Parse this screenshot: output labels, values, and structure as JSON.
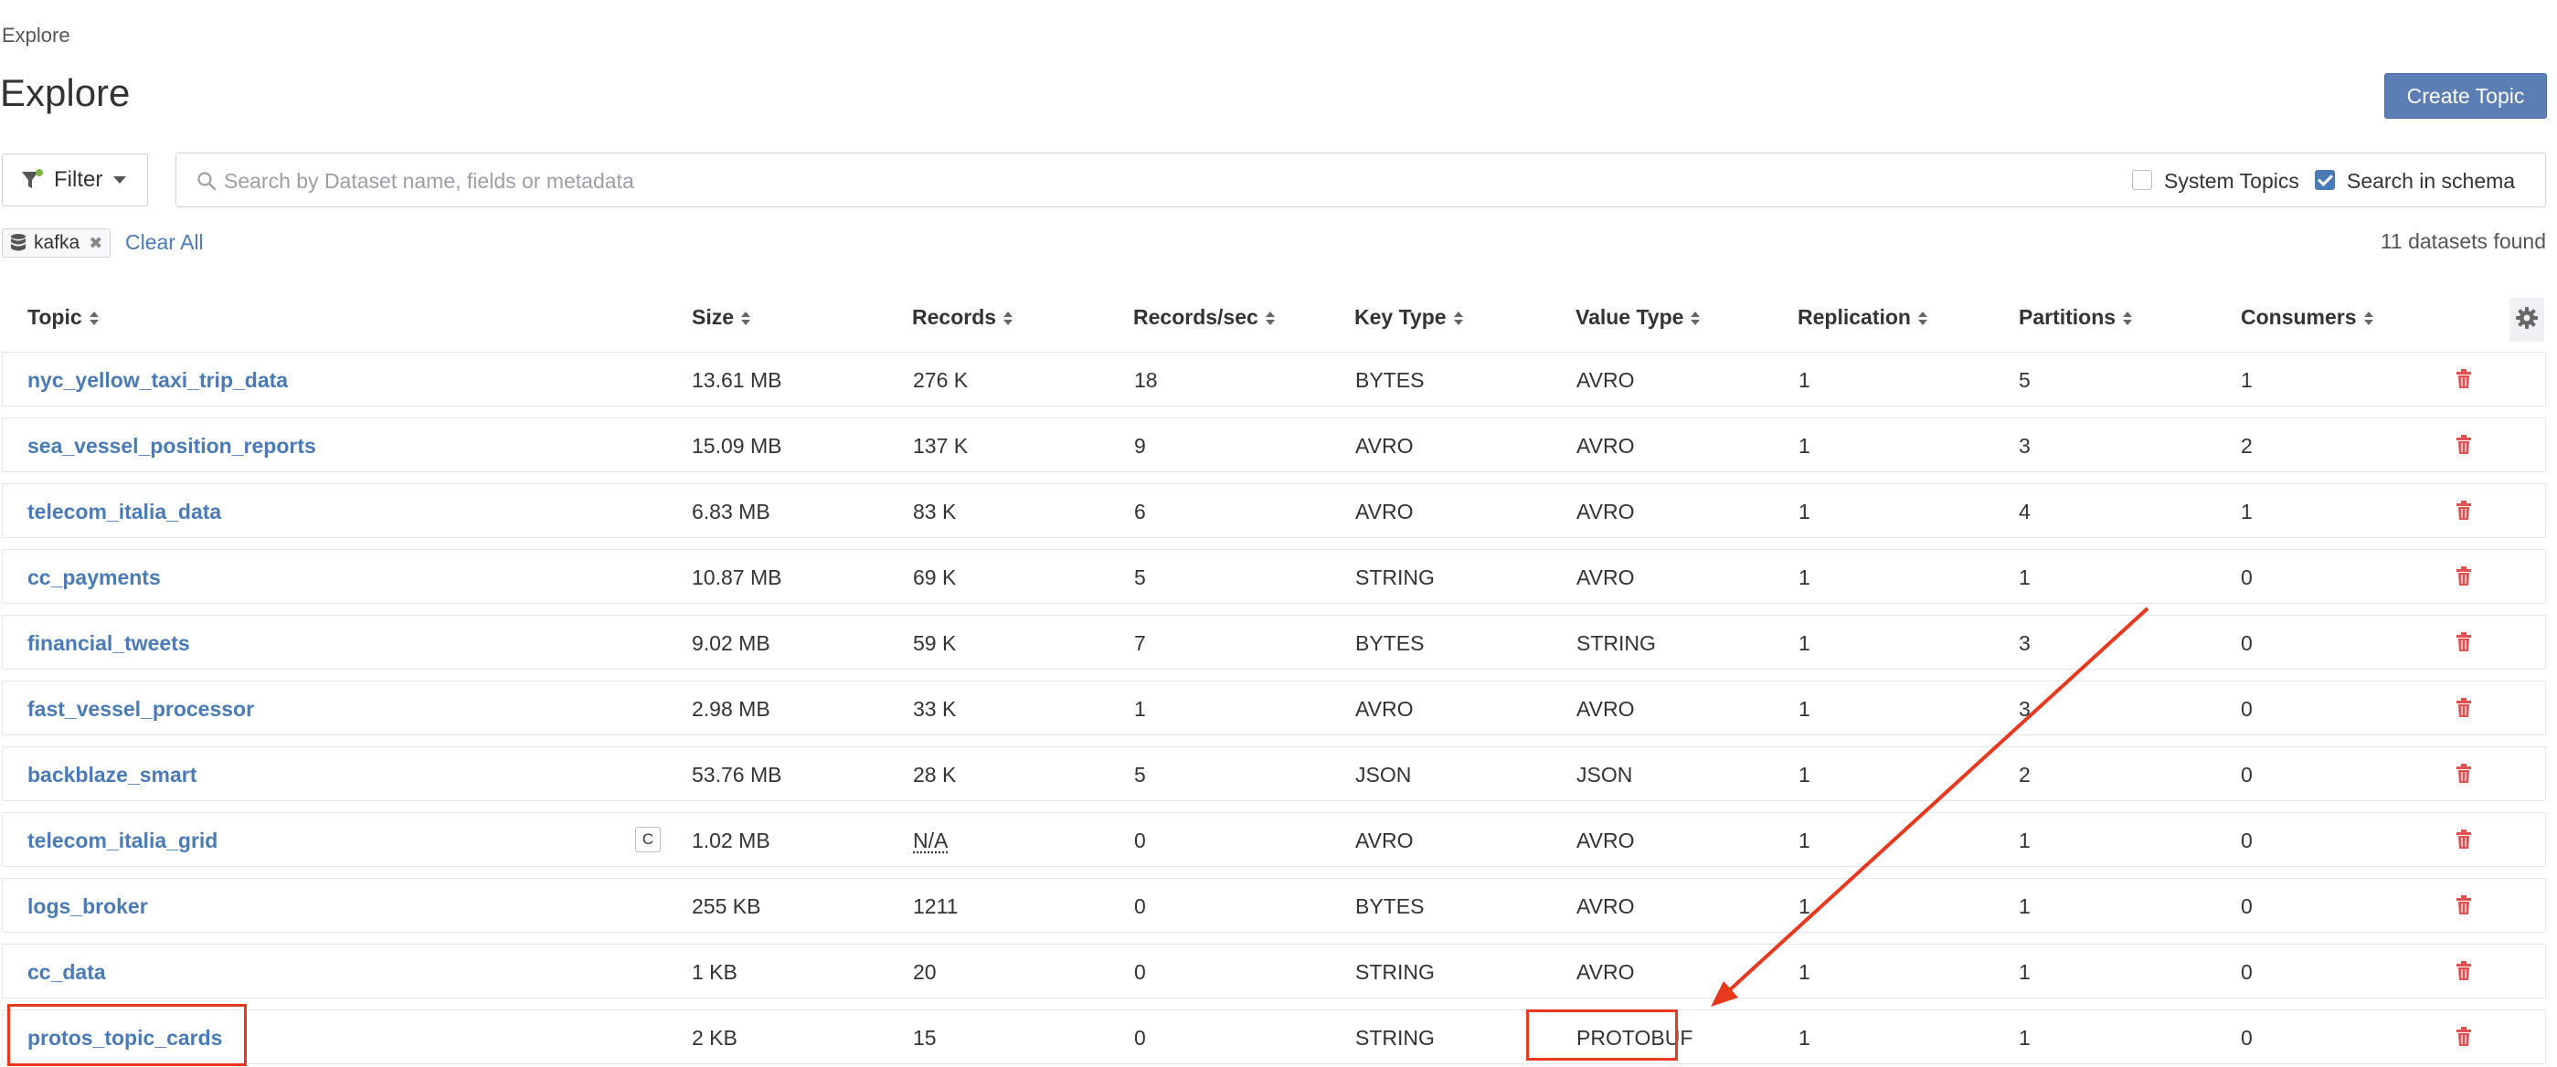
{
  "breadcrumb": "Explore",
  "page_title": "Explore",
  "create_topic_label": "Create Topic",
  "filter_label": "Filter",
  "search": {
    "placeholder": "Search by Dataset name, fields or metadata",
    "value": ""
  },
  "system_topics": {
    "label": "System Topics",
    "checked": false
  },
  "search_in_schema": {
    "label": "Search in schema",
    "checked": true
  },
  "active_tag": "kafka",
  "clear_all_label": "Clear All",
  "count_text": "11 datasets found",
  "columns": [
    "Topic",
    "Size",
    "Records",
    "Records/sec",
    "Key Type",
    "Value Type",
    "Replication",
    "Partitions",
    "Consumers"
  ],
  "rows": [
    {
      "topic": "nyc_yellow_taxi_trip_data",
      "size": "13.61 MB",
      "records": "276 K",
      "rps": "18",
      "key": "BYTES",
      "value": "AVRO",
      "replication": "1",
      "partitions": "5",
      "consumers": "1"
    },
    {
      "topic": "sea_vessel_position_reports",
      "size": "15.09 MB",
      "records": "137 K",
      "rps": "9",
      "key": "AVRO",
      "value": "AVRO",
      "replication": "1",
      "partitions": "3",
      "consumers": "2"
    },
    {
      "topic": "telecom_italia_data",
      "size": "6.83 MB",
      "records": "83 K",
      "rps": "6",
      "key": "AVRO",
      "value": "AVRO",
      "replication": "1",
      "partitions": "4",
      "consumers": "1"
    },
    {
      "topic": "cc_payments",
      "size": "10.87 MB",
      "records": "69 K",
      "rps": "5",
      "key": "STRING",
      "value": "AVRO",
      "replication": "1",
      "partitions": "1",
      "consumers": "0"
    },
    {
      "topic": "financial_tweets",
      "size": "9.02 MB",
      "records": "59 K",
      "rps": "7",
      "key": "BYTES",
      "value": "STRING",
      "replication": "1",
      "partitions": "3",
      "consumers": "0"
    },
    {
      "topic": "fast_vessel_processor",
      "size": "2.98 MB",
      "records": "33 K",
      "rps": "1",
      "key": "AVRO",
      "value": "AVRO",
      "replication": "1",
      "partitions": "3",
      "consumers": "0"
    },
    {
      "topic": "backblaze_smart",
      "size": "53.76 MB",
      "records": "28 K",
      "rps": "5",
      "key": "JSON",
      "value": "JSON",
      "replication": "1",
      "partitions": "2",
      "consumers": "0"
    },
    {
      "topic": "telecom_italia_grid",
      "badge": "C",
      "size": "1.02 MB",
      "records": "N/A",
      "rps": "0",
      "key": "AVRO",
      "value": "AVRO",
      "replication": "1",
      "partitions": "1",
      "consumers": "0"
    },
    {
      "topic": "logs_broker",
      "size": "255 KB",
      "records": "1211",
      "rps": "0",
      "key": "BYTES",
      "value": "AVRO",
      "replication": "1",
      "partitions": "1",
      "consumers": "0"
    },
    {
      "topic": "cc_data",
      "size": "1 KB",
      "records": "20",
      "rps": "0",
      "key": "STRING",
      "value": "AVRO",
      "replication": "1",
      "partitions": "1",
      "consumers": "0"
    },
    {
      "topic": "protos_topic_cards",
      "size": "2 KB",
      "records": "15",
      "rps": "0",
      "key": "STRING",
      "value": "PROTOBUF",
      "replication": "1",
      "partitions": "1",
      "consumers": "0"
    }
  ],
  "colors": {
    "accent": "#4a7bb7",
    "button": "#5b7fb5",
    "delete": "#e05252",
    "annotation": "#e8391f"
  },
  "icons": [
    "filter-icon",
    "search-icon",
    "database-icon",
    "gear-icon",
    "trash-icon",
    "sort-icon"
  ]
}
